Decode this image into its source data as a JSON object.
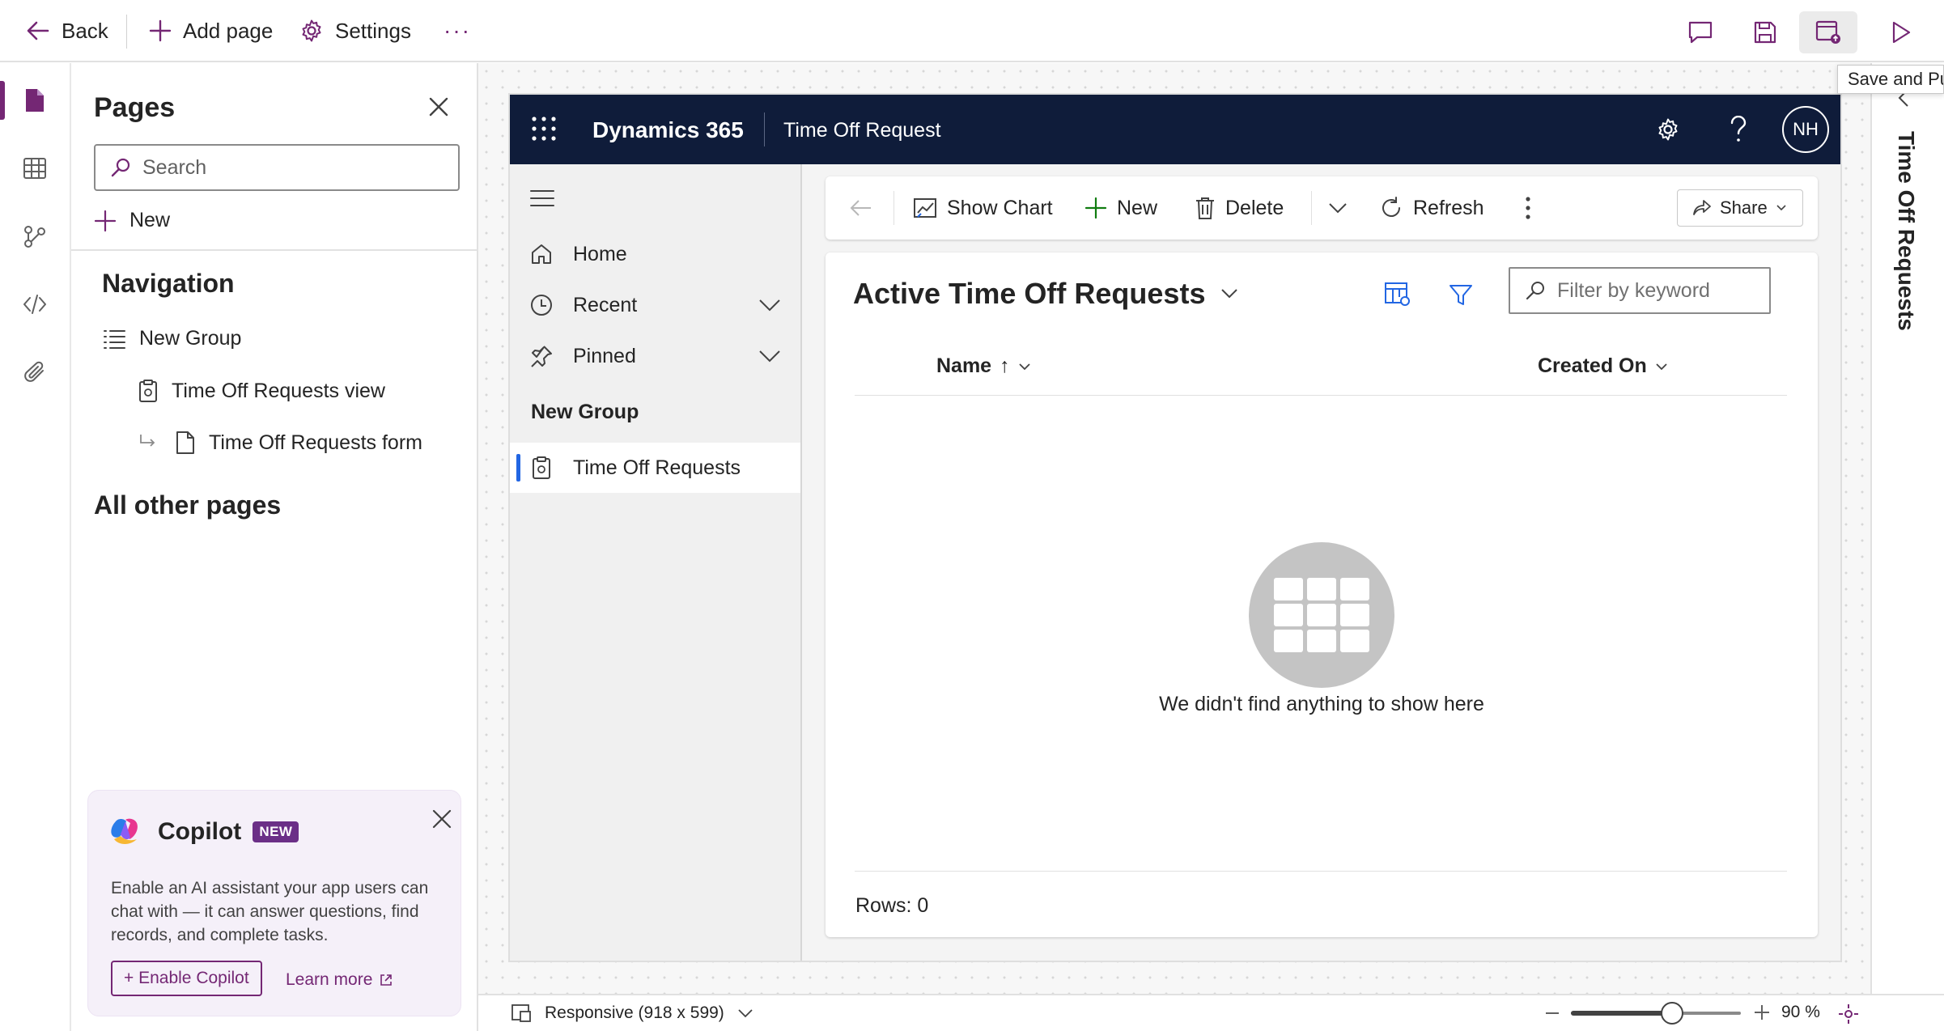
{
  "topbar": {
    "back_label": "Back",
    "add_page_label": "Add page",
    "settings_label": "Settings",
    "more_label": "···"
  },
  "tooltip": {
    "text": "Save and Publish"
  },
  "pages_panel": {
    "title": "Pages",
    "search_placeholder": "Search",
    "new_label": "New",
    "navigation_heading": "Navigation",
    "group_label": "New Group",
    "items": [
      {
        "label": "Time Off Requests view"
      },
      {
        "label": "Time Off Requests form"
      }
    ],
    "all_other_pages": "All other pages"
  },
  "copilot": {
    "title": "Copilot",
    "badge": "NEW",
    "description": "Enable an AI assistant your app users can chat with — it can answer questions, find records, and complete tasks.",
    "enable_label": "+ Enable Copilot",
    "learn_more_label": "Learn more"
  },
  "app": {
    "brand": "Dynamics 365",
    "app_name": "Time Off Request",
    "avatar_initials": "NH",
    "header_bg": "#0f1c3a"
  },
  "sitemap": {
    "home": "Home",
    "recent": "Recent",
    "pinned": "Pinned",
    "group": "New Group",
    "selected_item": "Time Off Requests"
  },
  "commands": {
    "show_chart": "Show Chart",
    "new": "New",
    "delete": "Delete",
    "refresh": "Refresh",
    "share": "Share"
  },
  "grid": {
    "view_title": "Active Time Off Requests",
    "filter_placeholder": "Filter by keyword",
    "col_name": "Name",
    "col_name_sort": "↑",
    "col_created": "Created On",
    "empty_message": "We didn't find anything to show here",
    "rows_label": "Rows: 0"
  },
  "statusbar": {
    "viewport_label": "Responsive (918 x 599)",
    "zoom_label": "90 %",
    "zoom_level_percent": 90
  },
  "right_pane": {
    "title": "Time Off Requests"
  },
  "colors": {
    "accent": "#742774",
    "selected_bar": "#2266e3"
  }
}
